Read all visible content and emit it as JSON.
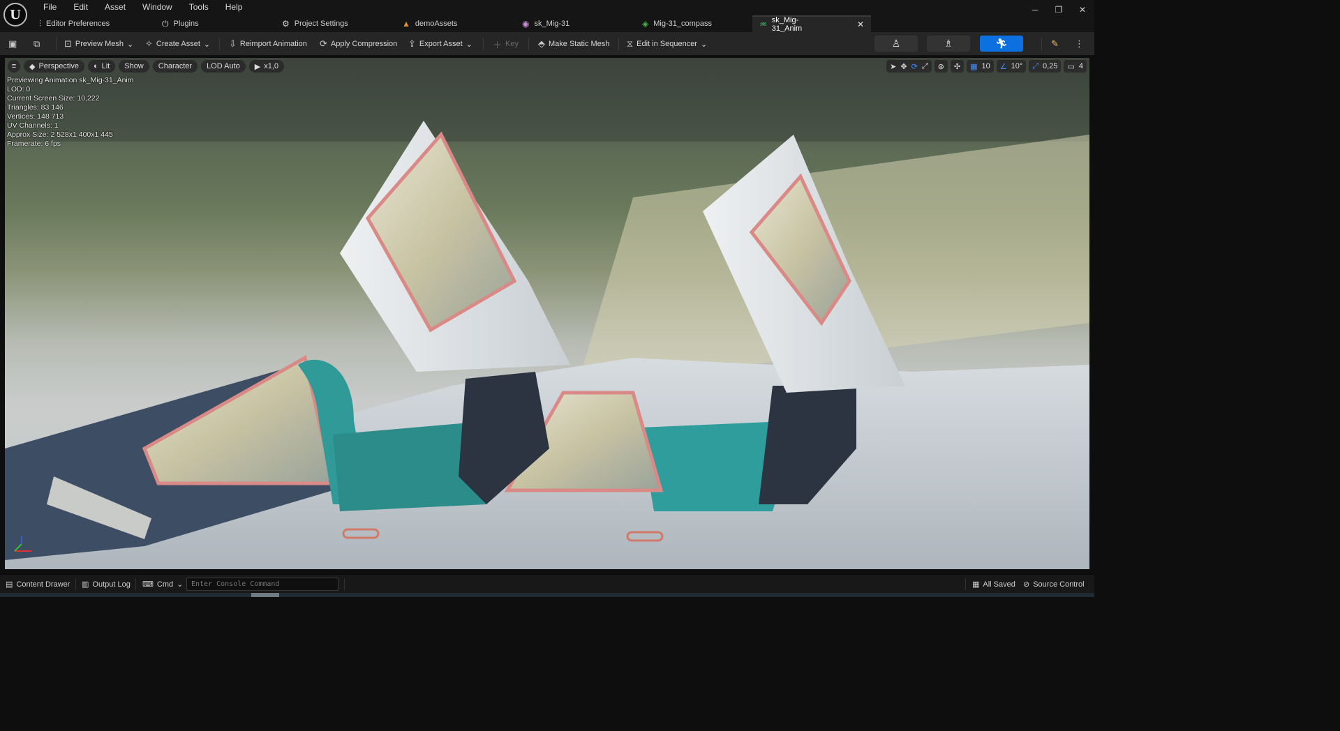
{
  "app": {
    "logo_letter": "U"
  },
  "menu": [
    "File",
    "Edit",
    "Asset",
    "Window",
    "Tools",
    "Help"
  ],
  "window_controls": {
    "minimize": "─",
    "restore": "❐",
    "close": "✕"
  },
  "tabs": [
    {
      "label": "Editor Preferences",
      "icon": "sliders-icon"
    },
    {
      "label": "Plugins",
      "icon": "plug-icon"
    },
    {
      "label": "Project Settings",
      "icon": "gear-icon"
    },
    {
      "label": "demoAssets",
      "icon": "folder-icon"
    },
    {
      "label": "sk_Mig-31",
      "icon": "skeleton-icon"
    },
    {
      "label": "Mig-31_compass",
      "icon": "static-mesh-icon"
    },
    {
      "label": "sk_Mig-31_Anim",
      "icon": "animation-icon",
      "active": true
    }
  ],
  "toolbar": {
    "preview_mesh": "Preview Mesh",
    "create_asset": "Create Asset",
    "reimport_animation": "Reimport Animation",
    "apply_compression": "Apply Compression",
    "export_asset": "Export Asset",
    "key": "Key",
    "make_static_mesh": "Make Static Mesh",
    "edit_in_sequencer": "Edit in Sequencer"
  },
  "viewport": {
    "controls": {
      "perspective": "Perspective",
      "lit": "Lit",
      "show": "Show",
      "character": "Character",
      "lod": "LOD Auto",
      "speed": "x1,0"
    },
    "right_controls": {
      "grid_snap": "10",
      "rotation_snap": "10°",
      "scale_snap": "0,25",
      "camera_speed": "4"
    },
    "stats": [
      "Previewing Animation sk_Mig-31_Anim",
      "LOD: 0",
      "Current Screen Size: 10,222",
      "Triangles: 83 146",
      "Vertices: 148 713",
      "UV Channels: 1",
      "Approx Size: 2 528x1 400x1 445",
      "Framerate: 6 fps"
    ]
  },
  "statusbar": {
    "content_drawer": "Content Drawer",
    "output_log": "Output Log",
    "cmd": "Cmd",
    "console_placeholder": "Enter Console Command",
    "all_saved": "All Saved",
    "source_control": "Source Control"
  },
  "colors": {
    "accent": "#0c70e0",
    "canopy_frame": "#d98a86",
    "cockpit_teal": "#2f9a97"
  }
}
